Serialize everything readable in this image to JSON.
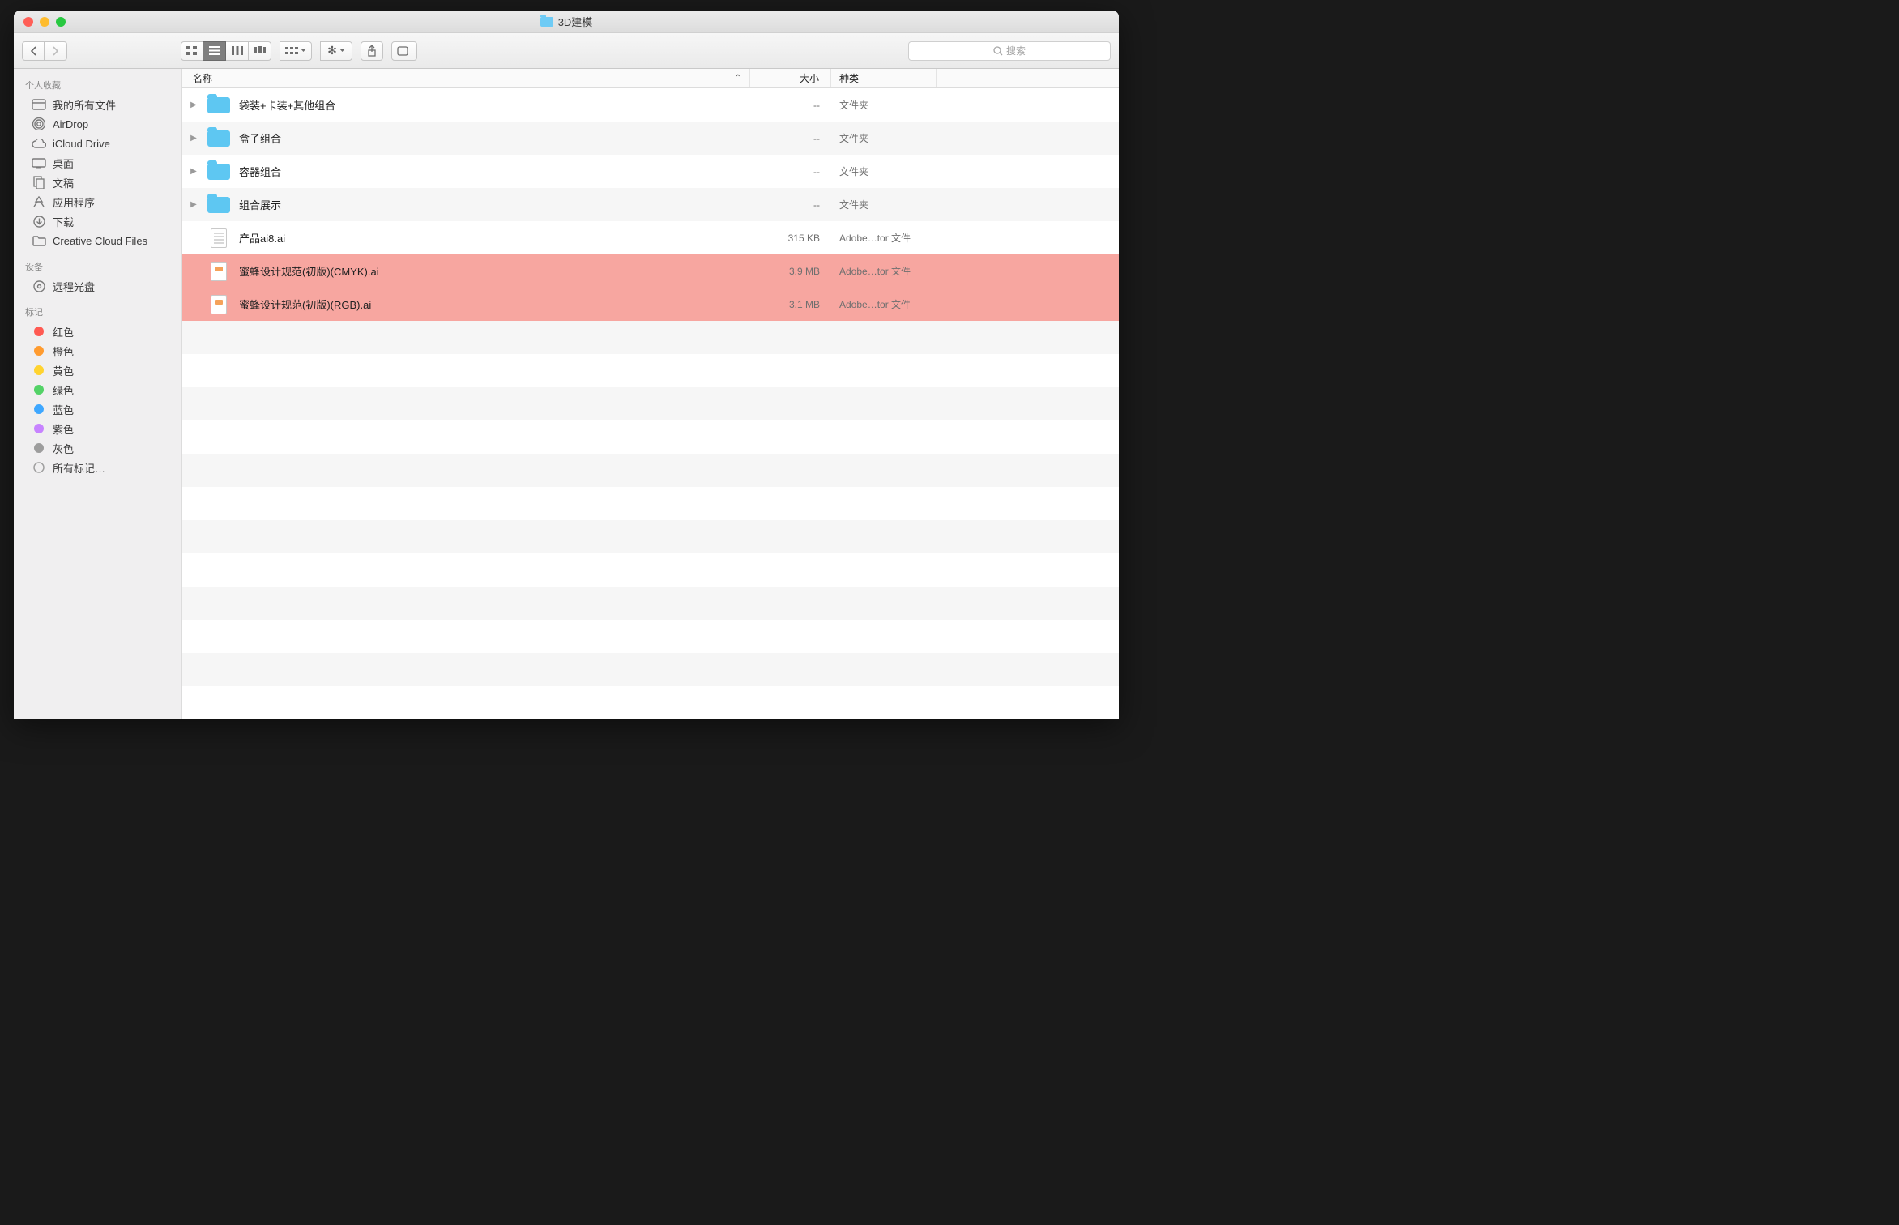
{
  "title": "3D建模",
  "search_placeholder": "搜索",
  "sidebar": {
    "favorites_header": "个人收藏",
    "favorites": [
      {
        "label": "我的所有文件",
        "icon": "all-files"
      },
      {
        "label": "AirDrop",
        "icon": "airdrop"
      },
      {
        "label": "iCloud Drive",
        "icon": "icloud"
      },
      {
        "label": "桌面",
        "icon": "desktop"
      },
      {
        "label": "文稿",
        "icon": "documents"
      },
      {
        "label": "应用程序",
        "icon": "applications"
      },
      {
        "label": "下载",
        "icon": "downloads"
      },
      {
        "label": "Creative Cloud Files",
        "icon": "folder"
      }
    ],
    "devices_header": "设备",
    "devices": [
      {
        "label": "远程光盘",
        "icon": "remote-disc"
      }
    ],
    "tags_header": "标记",
    "tags": [
      {
        "label": "红色",
        "color": "#ff5a52"
      },
      {
        "label": "橙色",
        "color": "#ff9b2f"
      },
      {
        "label": "黄色",
        "color": "#ffd32f"
      },
      {
        "label": "绿色",
        "color": "#53d267"
      },
      {
        "label": "蓝色",
        "color": "#3ea7ff"
      },
      {
        "label": "紫色",
        "color": "#c783ff"
      },
      {
        "label": "灰色",
        "color": "#9d9d9d"
      }
    ],
    "all_tags_label": "所有标记…"
  },
  "columns": {
    "name": "名称",
    "size": "大小",
    "kind": "种类"
  },
  "rows": [
    {
      "name": "袋装+卡装+其他组合",
      "size": "--",
      "kind": "文件夹",
      "type": "folder",
      "disclosure": true,
      "highlight": false
    },
    {
      "name": "盒子组合",
      "size": "--",
      "kind": "文件夹",
      "type": "folder",
      "disclosure": true,
      "highlight": false
    },
    {
      "name": "容器组合",
      "size": "--",
      "kind": "文件夹",
      "type": "folder",
      "disclosure": true,
      "highlight": false
    },
    {
      "name": "组合展示",
      "size": "--",
      "kind": "文件夹",
      "type": "folder",
      "disclosure": true,
      "highlight": false
    },
    {
      "name": "产品ai8.ai",
      "size": "315 KB",
      "kind": "Adobe…tor 文件",
      "type": "file-plain",
      "disclosure": false,
      "highlight": false
    },
    {
      "name": "蜜蜂设计规范(初版)(CMYK).ai",
      "size": "3.9 MB",
      "kind": "Adobe…tor 文件",
      "type": "file-ai",
      "disclosure": false,
      "highlight": true
    },
    {
      "name": "蜜蜂设计规范(初版)(RGB).ai",
      "size": "3.1 MB",
      "kind": "Adobe…tor 文件",
      "type": "file-ai",
      "disclosure": false,
      "highlight": true
    }
  ]
}
